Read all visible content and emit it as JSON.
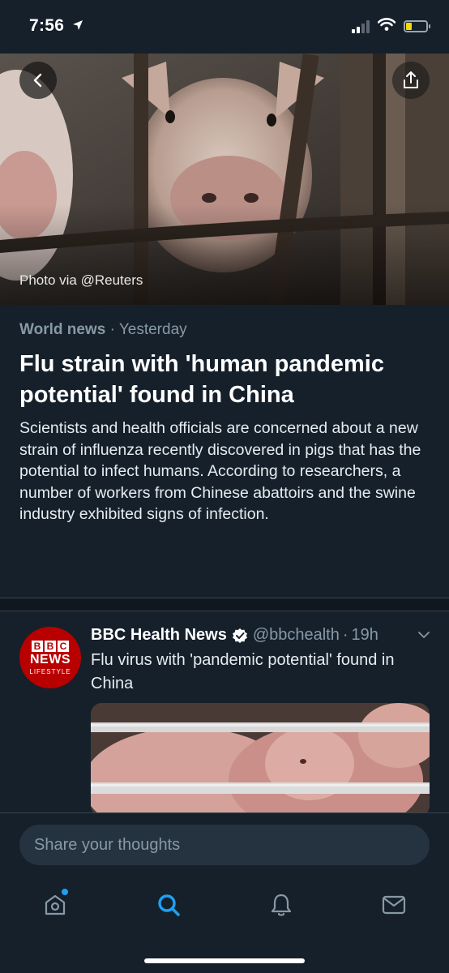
{
  "status_bar": {
    "time": "7:56",
    "location_arrow": "location-arrow-icon"
  },
  "hero": {
    "photo_credit": "Photo via @Reuters"
  },
  "article": {
    "category": "World news",
    "separator": "·",
    "date": "Yesterday",
    "headline": "Flu strain with 'human pandemic potential' found in China",
    "summary": "Scientists and health officials are concerned about a new strain of influenza recently discovered in pigs that has the potential to infect humans. According to researchers, a number of workers from Chinese abattoirs and the swine industry exhibited signs of infection."
  },
  "tweet": {
    "avatar": {
      "bbc_letters": [
        "B",
        "B",
        "C"
      ],
      "news": "NEWS",
      "sub": "LIFESTYLE"
    },
    "name": "BBC Health News",
    "handle": "@bbchealth",
    "separator": "·",
    "time": "19h",
    "text": "Flu virus with 'pandemic potential' found in China"
  },
  "composer": {
    "placeholder": "Share your thoughts"
  },
  "tabs": [
    {
      "name": "home",
      "icon": "home-icon",
      "active": false,
      "badge": true
    },
    {
      "name": "search",
      "icon": "search-icon",
      "active": true
    },
    {
      "name": "notifications",
      "icon": "bell-icon",
      "active": false
    },
    {
      "name": "messages",
      "icon": "mail-icon",
      "active": false
    }
  ],
  "colors": {
    "background": "#15202b",
    "accent": "#1da1f2",
    "secondary_text": "#8899a6",
    "battery_fill": "#f5d90a"
  }
}
